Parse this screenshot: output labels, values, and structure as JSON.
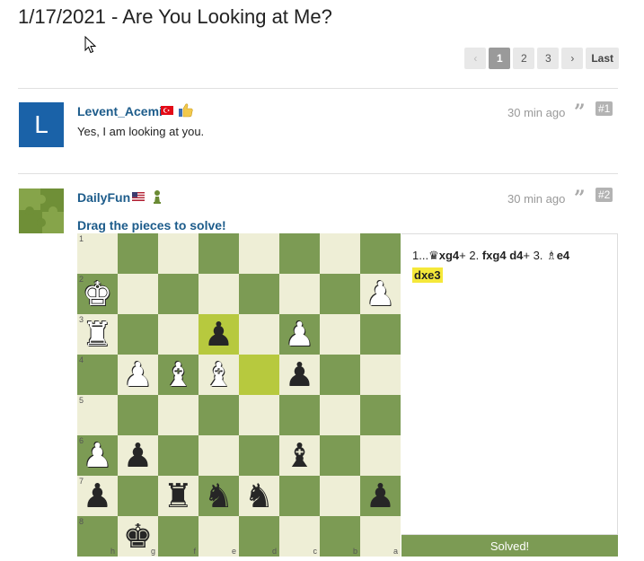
{
  "page": {
    "title": "1/17/2021 - Are You Looking at Me?"
  },
  "pagination": {
    "prev": "‹",
    "pages": [
      "1",
      "2",
      "3"
    ],
    "active": "1",
    "next": "›",
    "last": "Last"
  },
  "posts": [
    {
      "avatar_letter": "L",
      "avatar_color": "#1a62a8",
      "username": "Levent_Acemi",
      "time": "30 min ago",
      "quote_icon": "quote-icon",
      "number": "#1",
      "text": "Yes, I am looking at you."
    },
    {
      "avatar_icon": "puzzle-icon",
      "username": "DailyFun",
      "time": "30 min ago",
      "quote_icon": "quote-icon",
      "number": "#2",
      "puzzle_title": "Drag the pieces to solve!",
      "moves": {
        "m1": "1...",
        "m1_piece": "♛",
        "m1_black": "xg4",
        "m1_check": "+",
        "m2_num": "2.",
        "m2_white": "fxg4",
        "m2_black": "d4",
        "m2_check": "+",
        "m3_num": "3.",
        "m3_piece": "♗",
        "m3_white": "e4",
        "m3_black": "dxe3"
      },
      "status": "Solved!"
    }
  ],
  "board": {
    "colors": {
      "light": "#eeeed6",
      "dark": "#7c9b54",
      "highlight": "#b7c93e",
      "accent": "#7c9b54"
    },
    "ranks": [
      "1",
      "2",
      "3",
      "4",
      "5",
      "6",
      "7",
      "8"
    ],
    "files": [
      "h",
      "g",
      "f",
      "e",
      "d",
      "c",
      "b",
      "a"
    ],
    "pieces": [
      {
        "sq": "r2c1",
        "glyph": "♚",
        "color": "w"
      },
      {
        "sq": "r2c8",
        "glyph": "♟",
        "color": "w"
      },
      {
        "sq": "r3c1",
        "glyph": "♜",
        "color": "w"
      },
      {
        "sq": "r3c4",
        "glyph": "♟",
        "color": "b"
      },
      {
        "sq": "r3c6",
        "glyph": "♟",
        "color": "w"
      },
      {
        "sq": "r4c2",
        "glyph": "♟",
        "color": "w"
      },
      {
        "sq": "r4c3",
        "glyph": "♝",
        "color": "w"
      },
      {
        "sq": "r4c4",
        "glyph": "♝",
        "color": "w"
      },
      {
        "sq": "r4c6",
        "glyph": "♟",
        "color": "b"
      },
      {
        "sq": "r6c1",
        "glyph": "♟",
        "color": "w"
      },
      {
        "sq": "r6c2",
        "glyph": "♟",
        "color": "b"
      },
      {
        "sq": "r6c6",
        "glyph": "♝",
        "color": "b"
      },
      {
        "sq": "r7c1",
        "glyph": "♟",
        "color": "b"
      },
      {
        "sq": "r7c3",
        "glyph": "♜",
        "color": "b"
      },
      {
        "sq": "r7c4",
        "glyph": "♞",
        "color": "b"
      },
      {
        "sq": "r7c5",
        "glyph": "♞",
        "color": "b"
      },
      {
        "sq": "r7c8",
        "glyph": "♟",
        "color": "b"
      },
      {
        "sq": "r8c2",
        "glyph": "♚",
        "color": "b"
      }
    ],
    "highlights": [
      "r3c4",
      "r4c5"
    ]
  }
}
